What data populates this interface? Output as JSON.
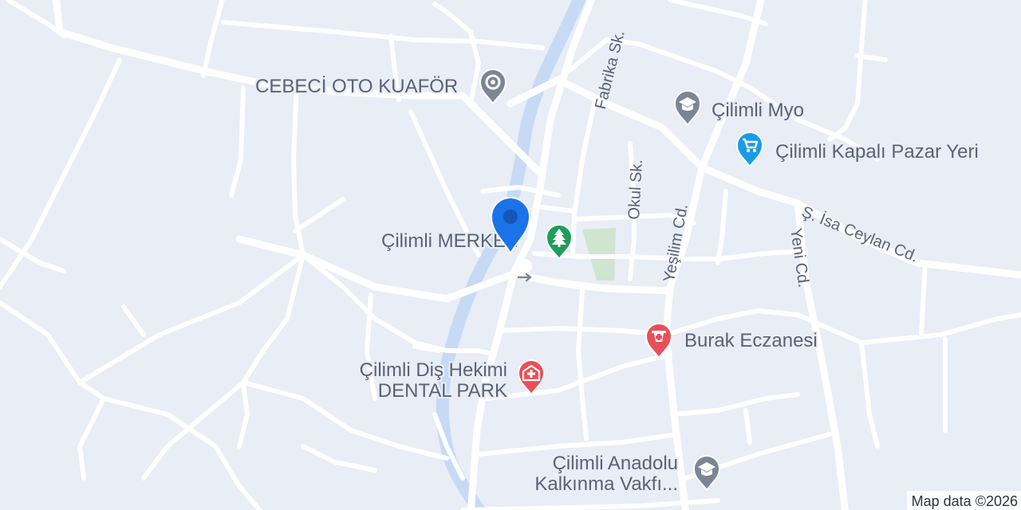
{
  "places": {
    "cebeci": "CEBECİ OTO KUAFÖR",
    "myo": "Çilimli Myo",
    "pazar": "Çilimli Kapalı Pazar Yeri",
    "merkez": "Çilimli MERKEZ",
    "eczane": "Burak Eczanesi",
    "dis_line1": "Çilimli Diş Hekimi",
    "dis_line2": "DENTAL PARK",
    "vakif_line1": "Çilimli Anadolu",
    "vakif_line2": "Kalkınma Vakfı..."
  },
  "streets": {
    "fabrika": "Fabrika Sk.",
    "okul": "Okul Sk.",
    "yesilim": "Yeşilim Cd.",
    "yeni": "Yeni Cd.",
    "isa": "Ş. İsa Ceylan Cd."
  },
  "attribution": "Map data ©2026",
  "colors": {
    "background": "#e8edf6",
    "road": "#ffffff",
    "river": "#c6daf5",
    "park": "#cfe5cf",
    "label": "#5b6374",
    "poi_gray": "#7c8594",
    "pharmacy": "#ea4f57",
    "shopping": "#1a9be8",
    "park_pin": "#1f9d5a",
    "location_pin": "#1a73e8"
  }
}
